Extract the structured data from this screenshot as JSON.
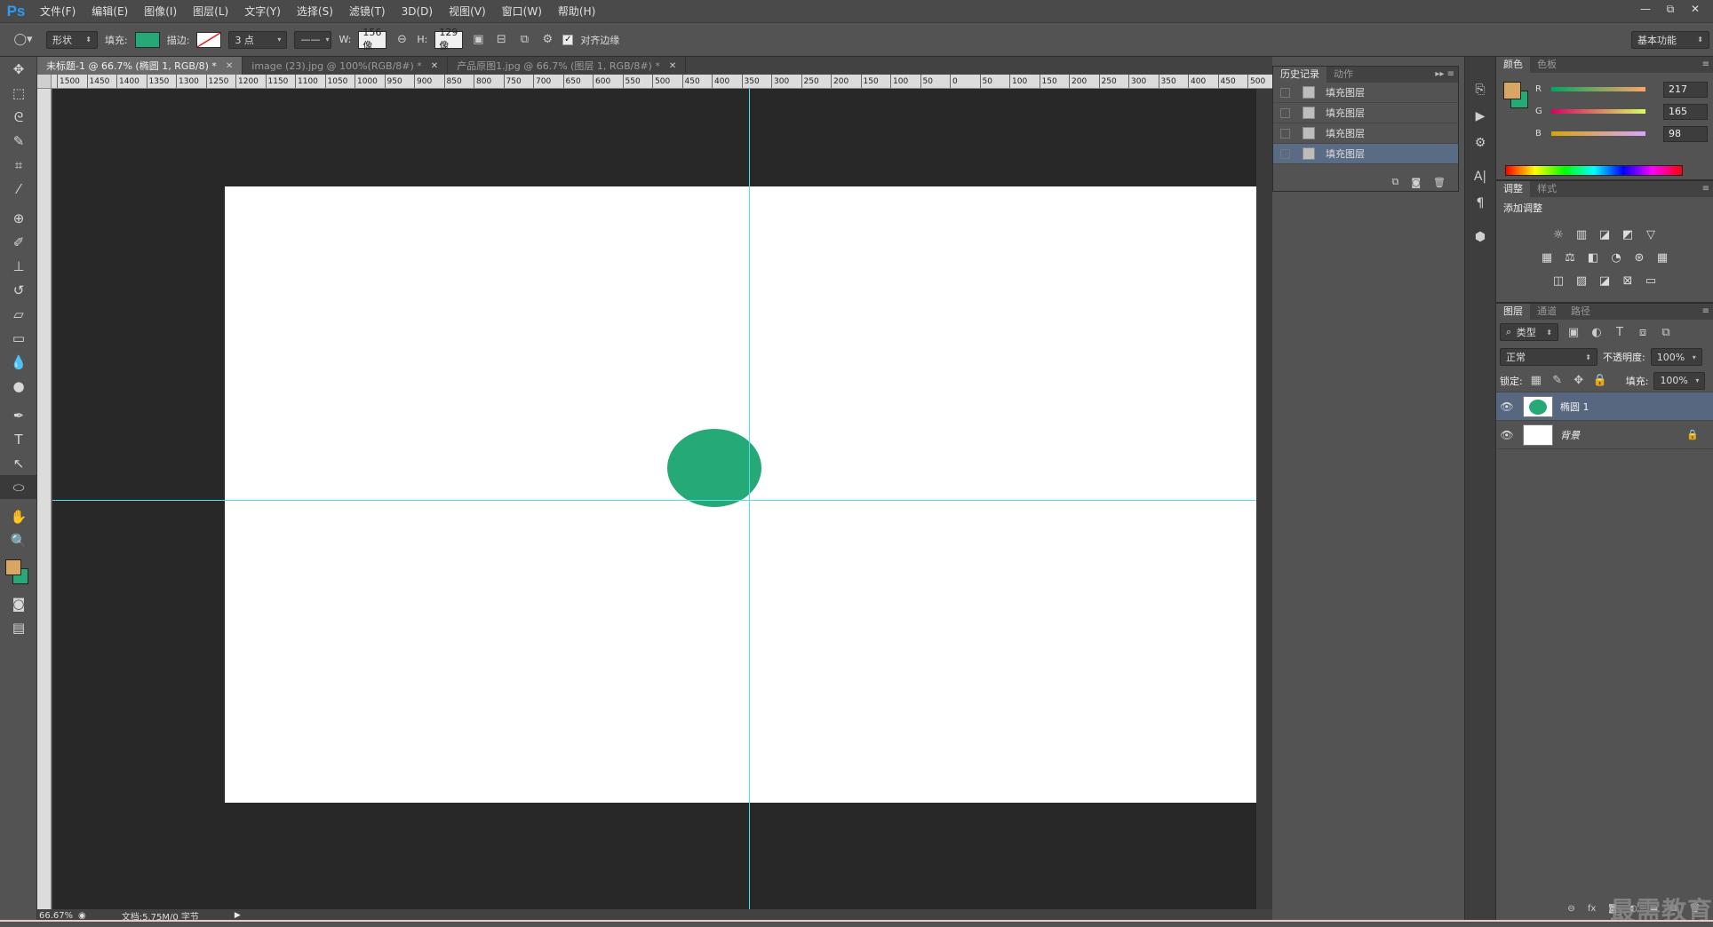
{
  "app": {
    "logo": "Ps"
  },
  "menu": [
    "文件(F)",
    "编辑(E)",
    "图像(I)",
    "图层(L)",
    "文字(Y)",
    "选择(S)",
    "滤镜(T)",
    "3D(D)",
    "视图(V)",
    "窗口(W)",
    "帮助(H)"
  ],
  "window_controls": [
    "—",
    "⧉",
    "✕"
  ],
  "options": {
    "mode": "形状",
    "fill_label": "填充:",
    "fill_color": "#25a977",
    "stroke_label": "描边:",
    "stroke_size": "3 点",
    "w_label": "W:",
    "w_value": "156 像",
    "h_label": "H:",
    "h_value": "129 像",
    "align_edges_label": "对齐边缘",
    "workspace": "基本功能"
  },
  "tabs": [
    {
      "label": "未标题-1 @ 66.7% (椭圆 1, RGB/8) *",
      "active": true
    },
    {
      "label": "image (23).jpg @ 100%(RGB/8#) *",
      "active": false
    },
    {
      "label": "产品原图1.jpg @ 66.7% (图层 1, RGB/8#) *",
      "active": false
    }
  ],
  "ruler_h_labels": [
    "1500",
    "1450",
    "1400",
    "1350",
    "1300",
    "1250",
    "1200",
    "1150",
    "1100",
    "1050",
    "1000",
    "950",
    "900",
    "850",
    "800",
    "750",
    "700",
    "650",
    "600",
    "550",
    "500",
    "450",
    "400",
    "350",
    "300",
    "250",
    "200",
    "150",
    "100",
    "50",
    "0",
    "50",
    "100",
    "150",
    "200",
    "250",
    "300",
    "350",
    "400",
    "450",
    "500"
  ],
  "status": {
    "zoom": "66.67%",
    "doc": "文档:5.75M/0 字节"
  },
  "history": {
    "tabs": [
      "历史记录",
      "动作"
    ],
    "items": [
      "填充图层",
      "填充图层",
      "填充图层",
      "填充图层"
    ],
    "selected_index": 3
  },
  "color_panel": {
    "tabs": [
      "颜色",
      "色板"
    ],
    "fg": "#d9a562",
    "bg": "#25a977",
    "channels": [
      {
        "name": "R",
        "value": "217"
      },
      {
        "name": "G",
        "value": "165"
      },
      {
        "name": "B",
        "value": "98"
      }
    ]
  },
  "adjust_panel": {
    "tabs": [
      "调整",
      "样式"
    ],
    "title": "添加调整"
  },
  "layers_panel": {
    "tabs": [
      "图层",
      "通道",
      "路径"
    ],
    "filter": "类型",
    "blend_mode": "正常",
    "opacity_label": "不透明度:",
    "opacity": "100%",
    "lock_label": "锁定:",
    "fill_label": "填充:",
    "fill": "100%",
    "layers": [
      {
        "name": "椭圆 1",
        "selected": true
      },
      {
        "name": "背景",
        "selected": false,
        "locked": true
      }
    ]
  },
  "watermark": "最需教育"
}
